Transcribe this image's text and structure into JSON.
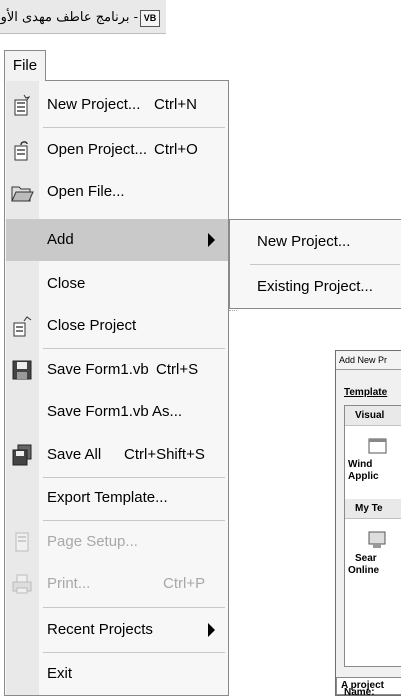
{
  "titlebar": {
    "app_icon_text": "VB",
    "title": "- برنامج عاطف مهدى الأول"
  },
  "menubar": {
    "file": "File"
  },
  "file_menu": {
    "items": [
      {
        "label": "New Project...",
        "shortcut": "Ctrl+N",
        "icon": "new-project-icon"
      },
      {
        "label": "Open Project...",
        "shortcut": "Ctrl+O",
        "icon": "open-project-icon"
      },
      {
        "label": "Open File...",
        "shortcut": "",
        "icon": "open-folder-icon"
      },
      {
        "label": "Add",
        "shortcut": "",
        "icon": "",
        "submenu": true,
        "highlighted": true
      },
      {
        "label": "Close",
        "shortcut": "",
        "icon": ""
      },
      {
        "label": "Close Project",
        "shortcut": "",
        "icon": "close-project-icon"
      },
      {
        "label": "Save Form1.vb",
        "shortcut": "Ctrl+S",
        "icon": "save-icon"
      },
      {
        "label": "Save Form1.vb As...",
        "shortcut": "",
        "icon": ""
      },
      {
        "label": "Save All",
        "shortcut": "Ctrl+Shift+S",
        "icon": "save-all-icon"
      },
      {
        "label": "Export Template...",
        "shortcut": "",
        "icon": ""
      },
      {
        "label": "Page Setup...",
        "shortcut": "",
        "icon": "page-setup-icon",
        "disabled": true
      },
      {
        "label": "Print...",
        "shortcut": "Ctrl+P",
        "icon": "print-icon",
        "disabled": true
      },
      {
        "label": "Recent Projects",
        "shortcut": "",
        "icon": "",
        "submenu": true
      },
      {
        "label": "Exit",
        "shortcut": "",
        "icon": ""
      }
    ]
  },
  "add_submenu": {
    "items": [
      {
        "label": "New Project..."
      },
      {
        "label": "Existing Project..."
      }
    ]
  },
  "dialog": {
    "title": "Add New Pr",
    "templates_label": "Template",
    "visual_header": "Visual",
    "windows_app": [
      "Wind",
      "Applic"
    ],
    "my_templates_header": "My Te",
    "search_online": [
      "Sear",
      "Online"
    ],
    "description": "A project",
    "name_label": "Name:"
  },
  "colors": {
    "highlight": "#c9c9c9",
    "menu_bg": "#f7f7f7",
    "icon_strip": "#e9e9e9",
    "disabled": "#a8a8a8"
  }
}
